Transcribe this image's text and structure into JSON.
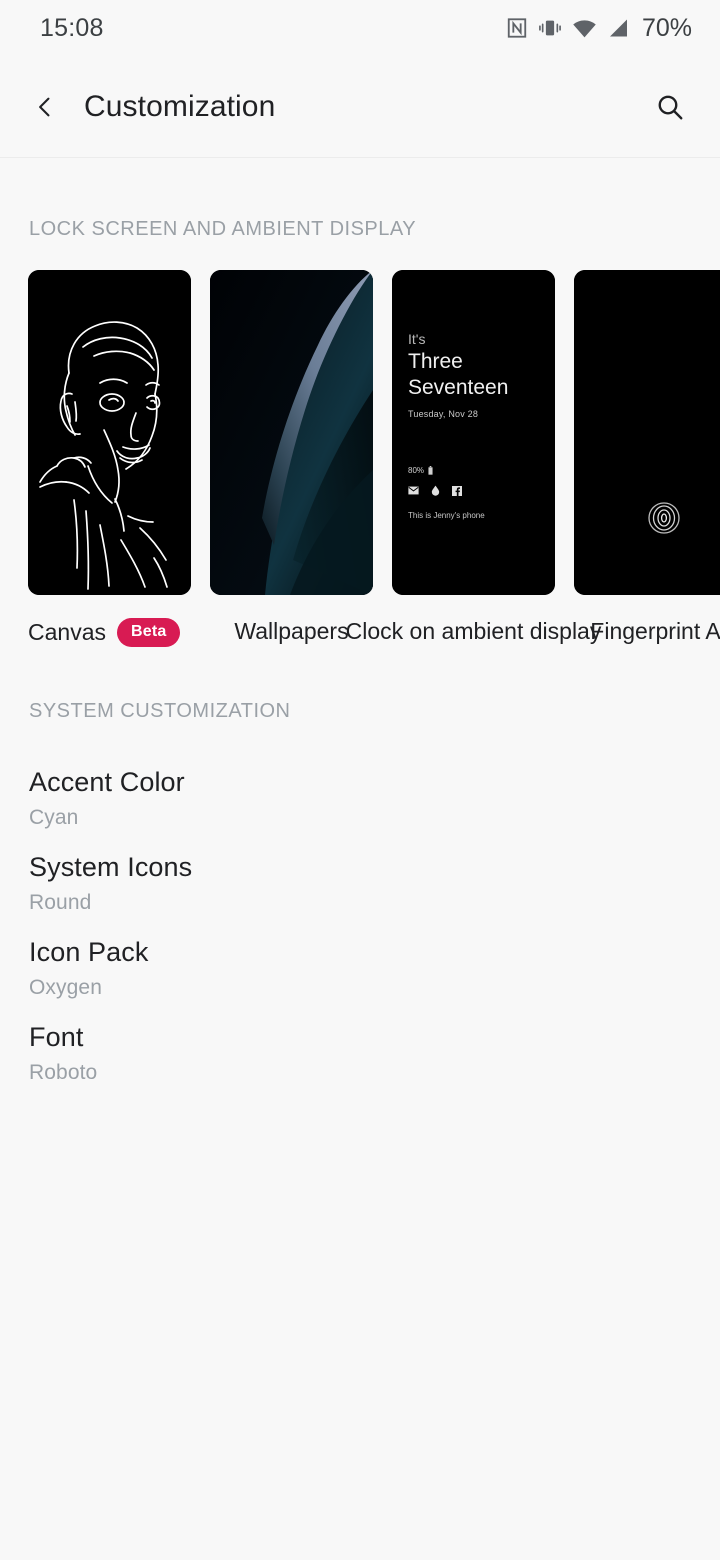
{
  "statusbar": {
    "time": "15:08",
    "battery_percent": "70%",
    "icons": [
      "nfc-icon",
      "vibrate-icon",
      "wifi-icon",
      "cellular-signal-icon"
    ]
  },
  "appbar": {
    "back_label": "back-icon",
    "title": "Customization",
    "search_label": "search-icon"
  },
  "sections": [
    {
      "header": "LOCK SCREEN AND AMBIENT DISPLAY",
      "cards": [
        {
          "label": "Canvas",
          "badge": "Beta",
          "art": "line-art-portrait"
        },
        {
          "label": "Wallpapers",
          "badge": "",
          "art": "abstract-blue-wallpaper"
        },
        {
          "label": "Clock on ambient display",
          "badge": "",
          "art": "ambient-clock-preview"
        },
        {
          "label": "Fingerprint A",
          "badge": "",
          "art": "fingerprint-preview"
        }
      ]
    },
    {
      "header": "SYSTEM CUSTOMIZATION",
      "rows": [
        {
          "title": "Accent Color",
          "value": "Cyan"
        },
        {
          "title": "System Icons",
          "value": "Round"
        },
        {
          "title": "Icon Pack",
          "value": "Oxygen"
        },
        {
          "title": "Font",
          "value": "Roboto"
        }
      ]
    }
  ],
  "ambient_preview": {
    "its": "It's",
    "hour_word": "Three",
    "minute_word": "Seventeen",
    "date": "Tuesday, Nov 28",
    "battery": "80%",
    "owner": "This is Jenny's phone",
    "notification_icons": [
      "mail-icon",
      "drop-icon",
      "facebook-icon"
    ]
  },
  "colors": {
    "background": "#f8f8f8",
    "primary_text": "#202124",
    "secondary_text": "#9aa0a6",
    "badge": "#d81b53",
    "card_background": "#000000"
  }
}
